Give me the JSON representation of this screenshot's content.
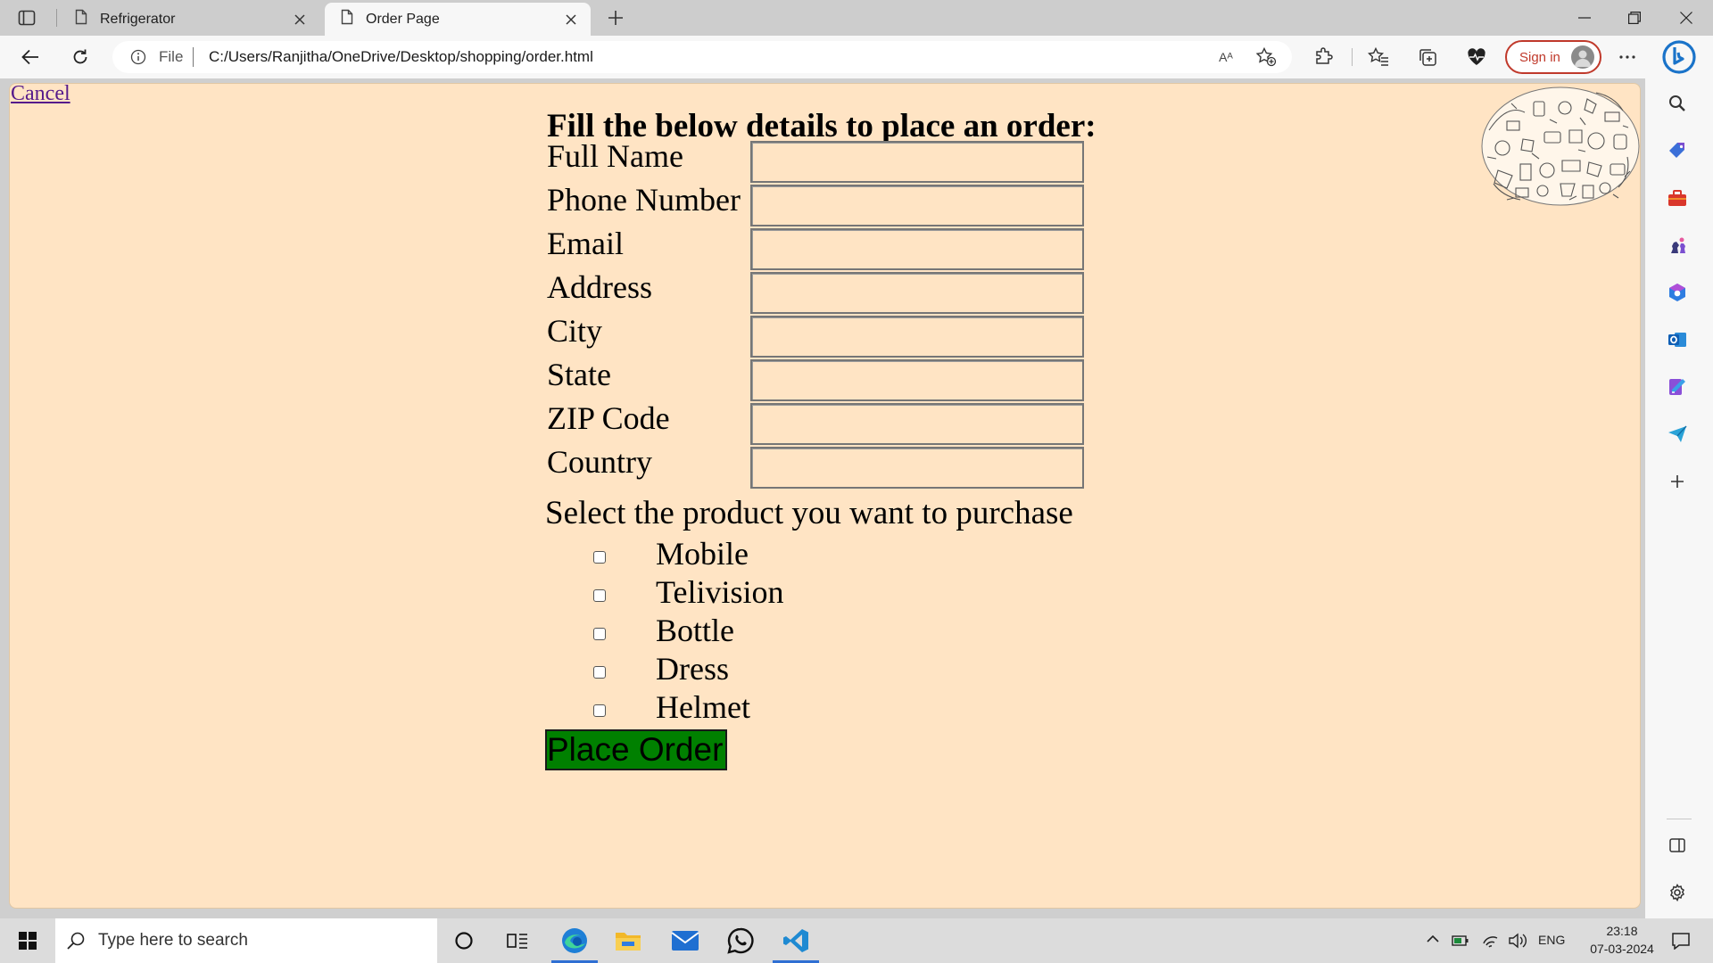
{
  "browser": {
    "tabs": [
      {
        "title": "Refrigerator",
        "active": false
      },
      {
        "title": "Order Page",
        "active": true
      }
    ],
    "address": {
      "scheme_label": "File",
      "url": "C:/Users/Ranjitha/OneDrive/Desktop/shopping/order.html",
      "read_aloud_glyph": "Aᴬ"
    },
    "sign_in_label": "Sign in"
  },
  "page": {
    "cancel_link": "Cancel",
    "heading": "Fill the below details to place an order:",
    "fields": [
      {
        "label": "Full Name",
        "value": ""
      },
      {
        "label": "Phone Number",
        "value": ""
      },
      {
        "label": "Email",
        "value": ""
      },
      {
        "label": "Address",
        "value": ""
      },
      {
        "label": "City",
        "value": ""
      },
      {
        "label": "State",
        "value": ""
      },
      {
        "label": "ZIP Code",
        "value": ""
      },
      {
        "label": "Country",
        "value": ""
      }
    ],
    "product_prompt": "Select the product you want to purchase",
    "products": [
      {
        "label": "Mobile",
        "checked": false
      },
      {
        "label": "Telivision",
        "checked": false
      },
      {
        "label": "Bottle",
        "checked": false
      },
      {
        "label": "Dress",
        "checked": false
      },
      {
        "label": "Helmet",
        "checked": false
      }
    ],
    "submit_label": "Place Order",
    "colors": {
      "page_background": "#ffe4c4",
      "submit_background": "#008000",
      "link": "#551a8b"
    }
  },
  "taskbar": {
    "search_placeholder": "Type here to search",
    "language": "ENG",
    "time": "23:18",
    "date": "07-03-2024"
  }
}
